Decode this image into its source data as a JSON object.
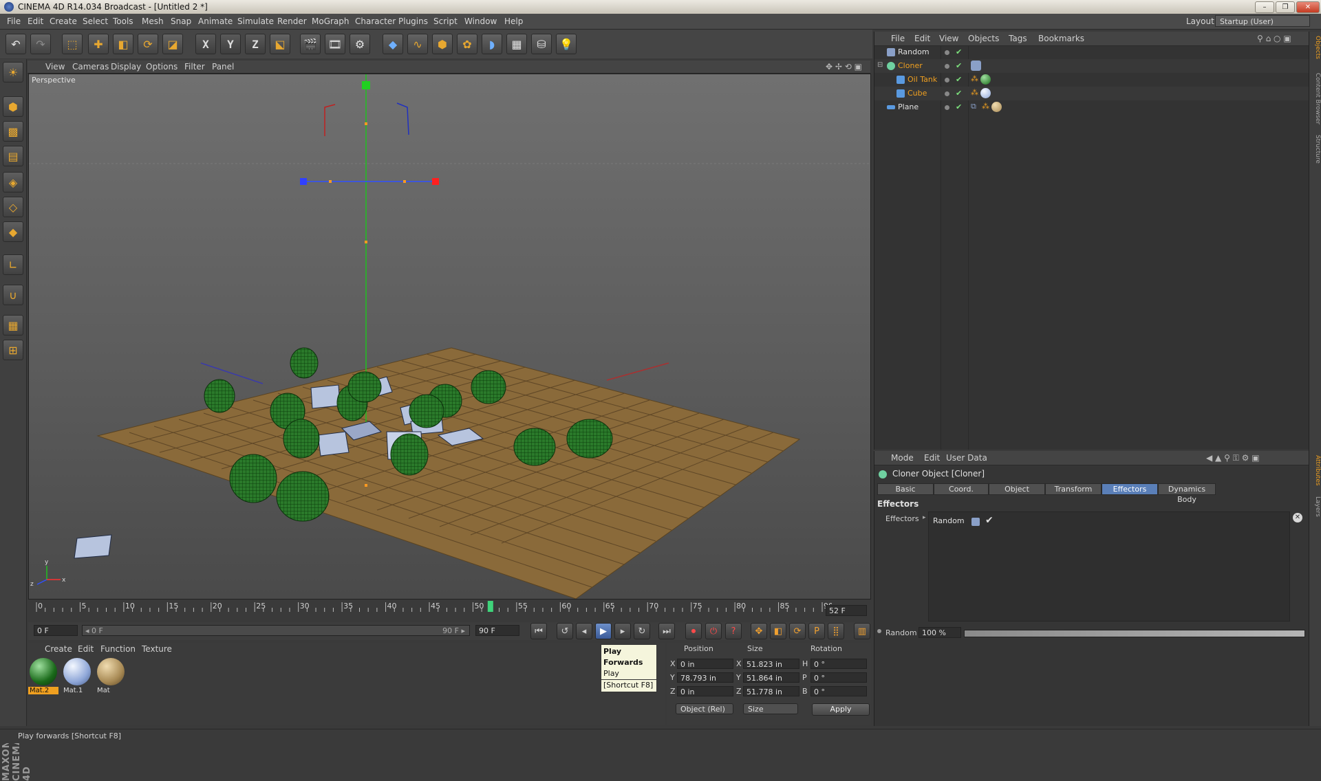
{
  "window": {
    "title": "CINEMA 4D R14.034 Broadcast - [Untitled 2 *]",
    "minimize": "–",
    "maximize": "❐",
    "close": "✕"
  },
  "menubar": [
    "File",
    "Edit",
    "Create",
    "Select",
    "Tools",
    "Mesh",
    "Snap",
    "Animate",
    "Simulate",
    "Render",
    "MoGraph",
    "Character",
    "Plugins",
    "Script",
    "Window",
    "Help"
  ],
  "layout": {
    "label": "Layout:",
    "value": "Startup (User)"
  },
  "viewport": {
    "menu": [
      "View",
      "Cameras",
      "Display",
      "Options",
      "Filter",
      "Panel"
    ],
    "label": "Perspective"
  },
  "timeline": {
    "ticks": [
      "0",
      "5",
      "10",
      "15",
      "20",
      "25",
      "30",
      "35",
      "40",
      "45",
      "50",
      "55",
      "60",
      "65",
      "70",
      "75",
      "80",
      "85",
      "90"
    ],
    "current_frame": 52,
    "current_frame_label": "52 F",
    "max_frame": 90
  },
  "playback": {
    "start": "0 F",
    "range_start": "◂ 0 F",
    "range_end": "90 F ▸",
    "end": "90 F"
  },
  "tooltip": {
    "title": "Play Forwards",
    "line1": "Play forwards",
    "line2": "[Shortcut F8]"
  },
  "materials": {
    "menu": [
      "Create",
      "Edit",
      "Function",
      "Texture"
    ],
    "items": [
      {
        "label": "Mat.2",
        "color": "#2a8a2a",
        "selected": true
      },
      {
        "label": "Mat.1",
        "color": "#8fa7d8",
        "selected": false
      },
      {
        "label": "Mat",
        "color": "#a88a55",
        "selected": false
      }
    ]
  },
  "coords": {
    "headers": [
      "Position",
      "Size",
      "Rotation"
    ],
    "rows": [
      {
        "pos_axis": "X",
        "pos": "0 in",
        "size_axis": "X",
        "size": "51.823 in",
        "rot_axis": "H",
        "rot": "0 °"
      },
      {
        "pos_axis": "Y",
        "pos": "78.793 in",
        "size_axis": "Y",
        "size": "51.864 in",
        "rot_axis": "P",
        "rot": "0 °"
      },
      {
        "pos_axis": "Z",
        "pos": "0 in",
        "size_axis": "Z",
        "size": "51.778 in",
        "rot_axis": "B",
        "rot": "0 °"
      }
    ],
    "mode_select": "Object (Rel)",
    "size_select": "Size",
    "apply": "Apply"
  },
  "status": "Play forwards [Shortcut F8]",
  "objects": {
    "menu": [
      "File",
      "Edit",
      "View",
      "Objects",
      "Tags",
      "Bookmarks"
    ],
    "rows": [
      {
        "name": "Random",
        "highlight": false,
        "indent": 0
      },
      {
        "name": "Cloner",
        "highlight": true,
        "indent": 0
      },
      {
        "name": "Oil Tank",
        "highlight": true,
        "indent": 1
      },
      {
        "name": "Cube",
        "highlight": true,
        "indent": 1
      },
      {
        "name": "Plane",
        "highlight": false,
        "indent": 0
      }
    ]
  },
  "attributes": {
    "menu": [
      "Mode",
      "Edit",
      "User Data"
    ],
    "title": "Cloner Object [Cloner]",
    "tabs": [
      "Basic",
      "Coord.",
      "Object",
      "Transform",
      "Effectors",
      "Dynamics Body"
    ],
    "active_tab": "Effectors",
    "section": "Effectors",
    "effectors_label": "Effectors",
    "effector_item": "Random",
    "random_label": "Random",
    "random_value": "100 %",
    "random_fraction": 1.0
  },
  "side_tabs": [
    "Objects",
    "Content Browser",
    "Structure",
    "Attributes",
    "Layers"
  ],
  "colors": {
    "accent": "#f0a020",
    "active_tab": "#5a7fb8",
    "floor": "#8a6a3a",
    "cylinder": "#1f6a1f",
    "box": "#b7c4de"
  }
}
